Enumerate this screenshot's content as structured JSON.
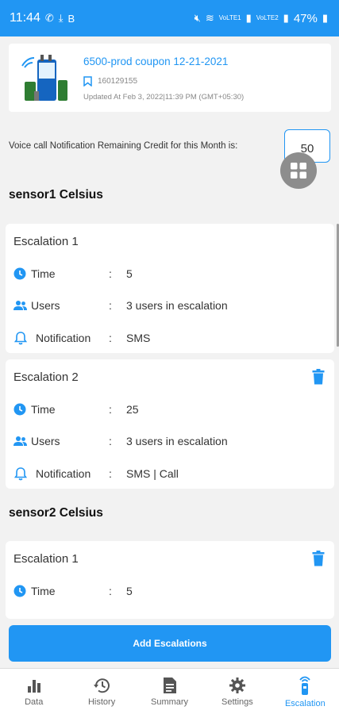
{
  "status_bar": {
    "time": "11:44",
    "carrier1": "VoLTE1",
    "carrier2": "VoLTE2",
    "battery": "47%"
  },
  "device": {
    "title": "6500-prod coupon 12-21-2021",
    "id": "160129155",
    "updated": "Updated At Feb 3, 2022|11:39 PM (GMT+05:30)"
  },
  "credit": {
    "label": "Voice call Notification Remaining Credit for this Month is:",
    "value": "50"
  },
  "sensors": [
    {
      "heading": "sensor1 Celsius",
      "escalations": [
        {
          "title": "Escalation 1",
          "time_label": "Time",
          "time": "5",
          "users_label": "Users",
          "users": "3 users in escalation",
          "notification_label": "Notification",
          "notification": "SMS",
          "colon": ":"
        },
        {
          "title": "Escalation 2",
          "time_label": "Time",
          "time": "25",
          "users_label": "Users",
          "users": "3 users in escalation",
          "notification_label": "Notification",
          "notification": "SMS | Call",
          "colon": ":"
        }
      ]
    },
    {
      "heading": "sensor2 Celsius",
      "escalations": [
        {
          "title": "Escalation 1",
          "time_label": "Time",
          "time": "5",
          "colon": ":"
        }
      ]
    }
  ],
  "add_button": "Add Escalations",
  "nav": [
    {
      "label": "Data",
      "icon": "bar-chart-icon"
    },
    {
      "label": "History",
      "icon": "history-icon"
    },
    {
      "label": "Summary",
      "icon": "document-icon"
    },
    {
      "label": "Settings",
      "icon": "gear-icon"
    },
    {
      "label": "Escalation",
      "icon": "escalation-icon",
      "active": true
    }
  ],
  "colors": {
    "accent": "#2196f3",
    "background": "#f2f2f2"
  }
}
